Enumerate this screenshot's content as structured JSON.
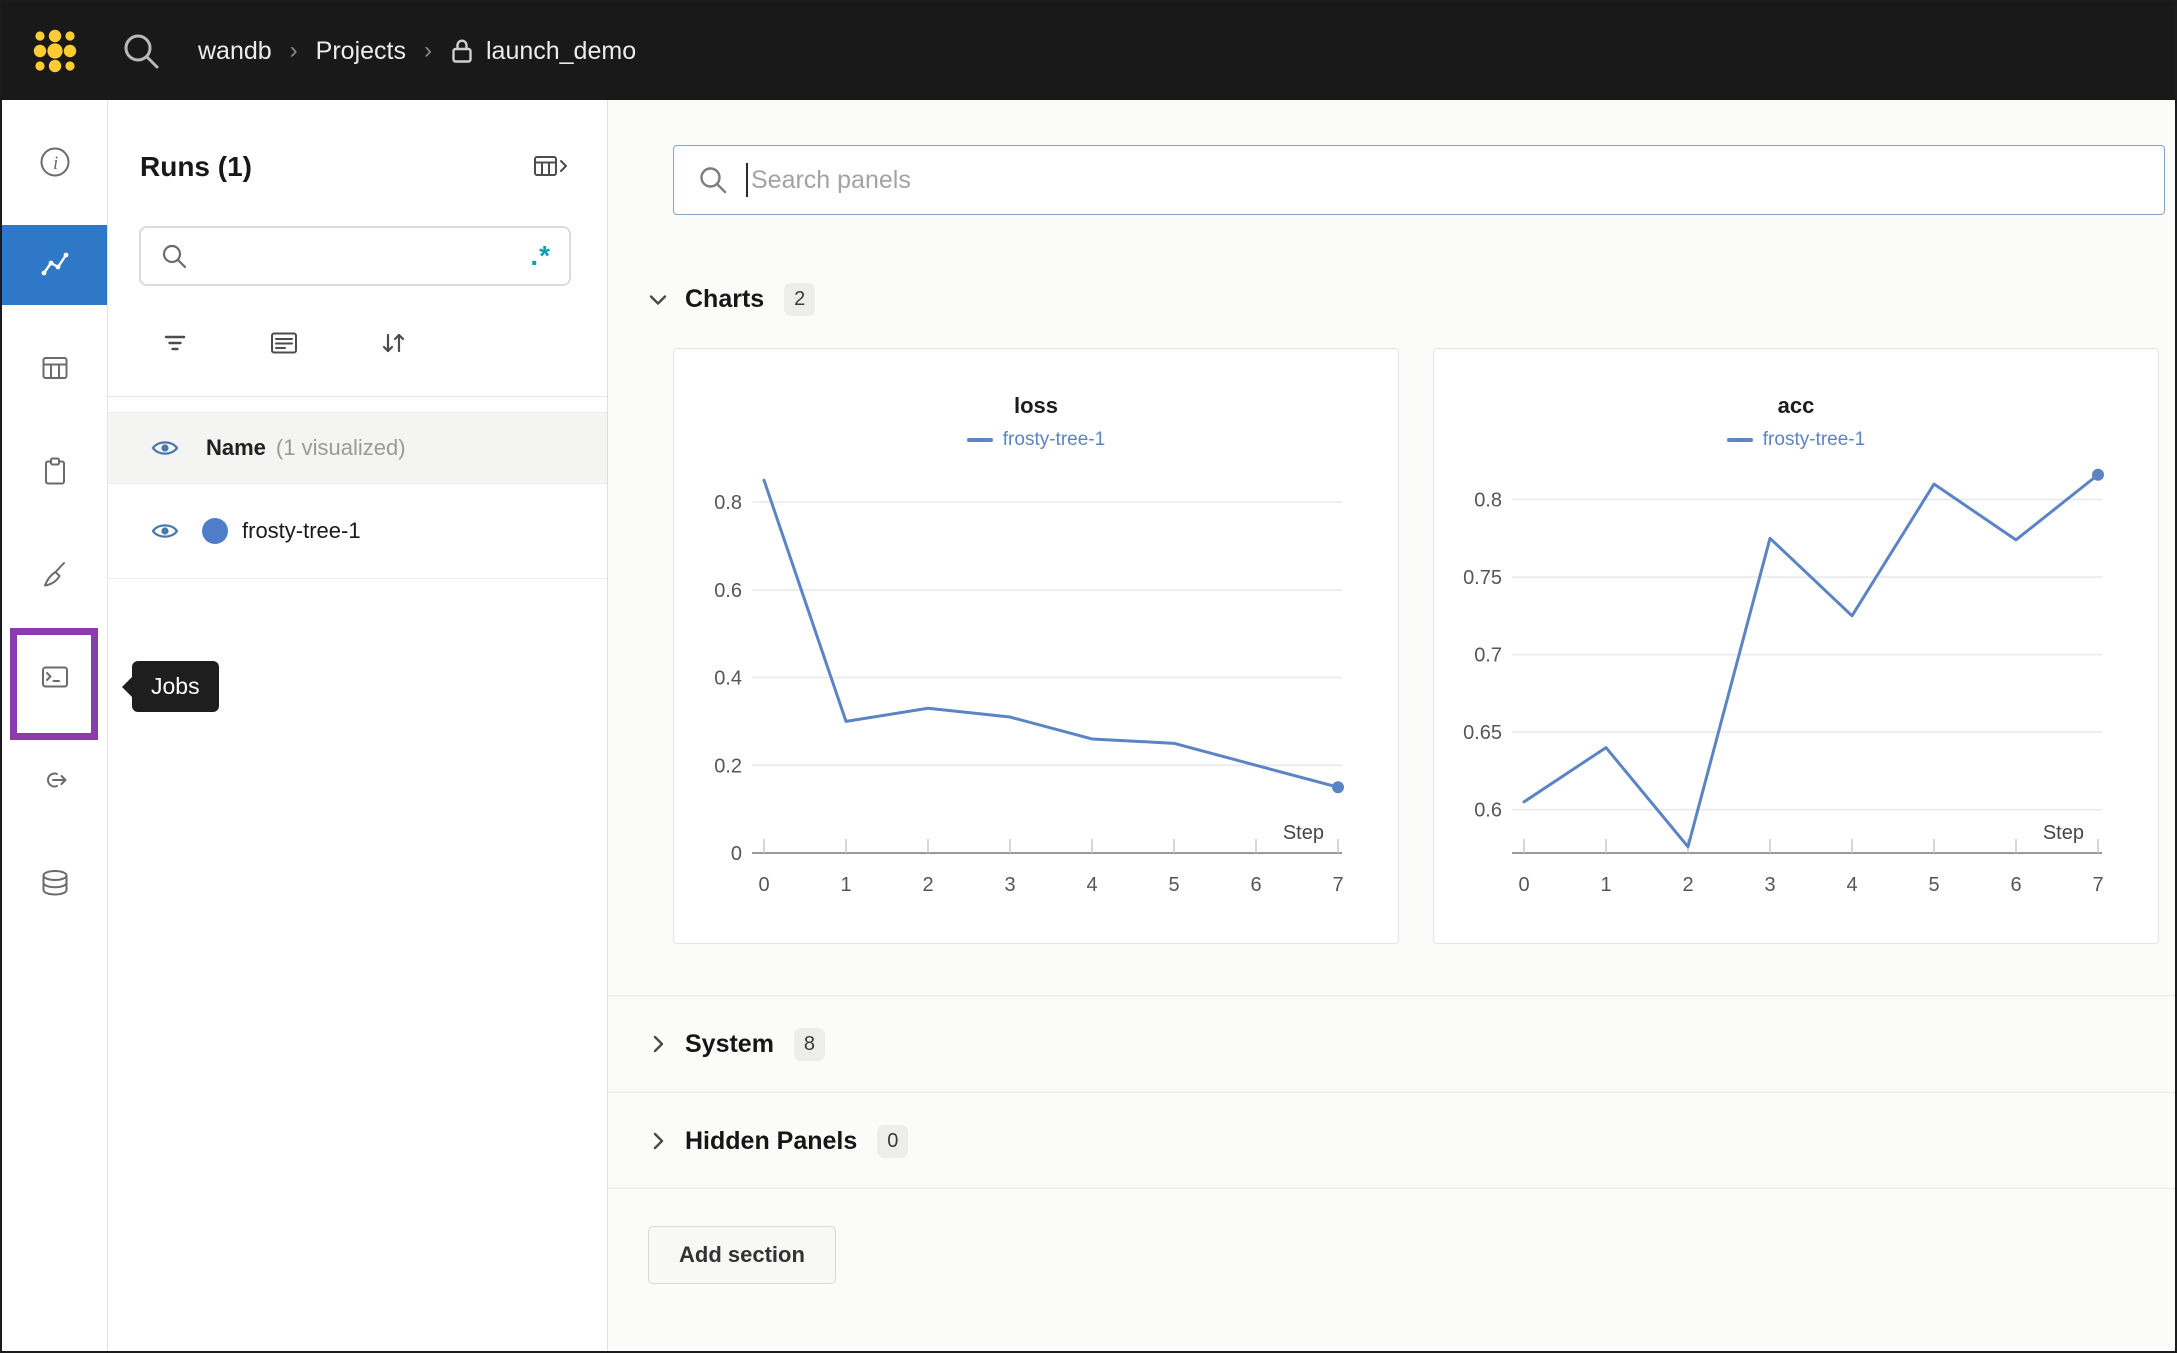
{
  "topbar": {
    "breadcrumb": [
      "wandb",
      "Projects",
      "launch_demo"
    ]
  },
  "sidebar": {
    "jobs_tooltip": "Jobs",
    "selected_item": "charts"
  },
  "colors": {
    "selected_blue": "#2e78c7",
    "highlight_purple": "#8c3bad",
    "regex_teal": "#0a9fb8",
    "line_blue": "#5b84c4"
  },
  "runs_panel": {
    "title": "Runs (1)",
    "search_value": "",
    "regex_label": ".*",
    "header": {
      "name": "Name",
      "suffix": "(1 visualized)"
    },
    "runs": [
      {
        "name": "frosty-tree-1",
        "color": "#4f7dc9"
      }
    ]
  },
  "main": {
    "search_placeholder": "Search panels",
    "sections": [
      {
        "label": "Charts",
        "count": "2"
      },
      {
        "label": "System",
        "count": "8"
      },
      {
        "label": "Hidden Panels",
        "count": "0"
      }
    ],
    "add_section": "Add section"
  },
  "chart_data": [
    {
      "type": "line",
      "title": "loss",
      "xlabel": "Step",
      "x": [
        0,
        1,
        2,
        3,
        4,
        5,
        6,
        7
      ],
      "series": [
        {
          "name": "frosty-tree-1",
          "color": "#5b84c4",
          "values": [
            0.85,
            0.3,
            0.33,
            0.31,
            0.26,
            0.25,
            0.2,
            0.15
          ]
        }
      ],
      "yticks": [
        0,
        0.2,
        0.4,
        0.6,
        0.8
      ],
      "ylim": [
        0,
        0.88
      ],
      "xlim": [
        0,
        7
      ],
      "grid": true,
      "legend_position": "top",
      "end_dot": true
    },
    {
      "type": "line",
      "title": "acc",
      "xlabel": "Step",
      "x": [
        0,
        1,
        2,
        3,
        4,
        5,
        6,
        7
      ],
      "series": [
        {
          "name": "frosty-tree-1",
          "color": "#5b84c4",
          "values": [
            0.605,
            0.64,
            0.576,
            0.775,
            0.725,
            0.81,
            0.774,
            0.816
          ]
        }
      ],
      "yticks": [
        0.6,
        0.65,
        0.7,
        0.75,
        0.8
      ],
      "ylim": [
        0.572,
        0.821
      ],
      "xlim": [
        0,
        7
      ],
      "grid": true,
      "legend_position": "top",
      "end_dot": true
    }
  ]
}
